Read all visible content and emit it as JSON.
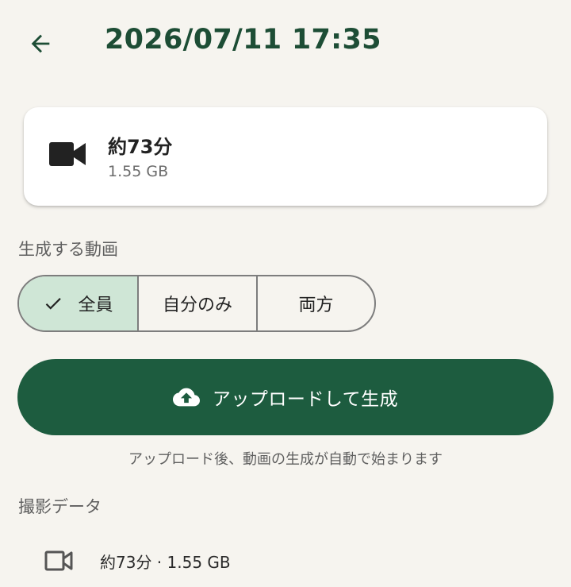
{
  "header": {
    "title": "2026/07/11 17:35",
    "back_icon": "arrow-left-icon"
  },
  "recording": {
    "duration": "約73分",
    "size": "1.55 GB",
    "icon": "videocam-icon"
  },
  "video_section": {
    "label": "生成する動画",
    "options": [
      {
        "label": "全員",
        "selected": true
      },
      {
        "label": "自分のみ",
        "selected": false
      },
      {
        "label": "両方",
        "selected": false
      }
    ]
  },
  "upload": {
    "button_label": "アップロードして生成",
    "hint": "アップロード後、動画の生成が自動で始まります",
    "icon": "cloud-upload-icon"
  },
  "capture_data": {
    "label": "撮影データ",
    "row_text": "約73分 · 1.55 GB",
    "icon": "videocam-outline-icon"
  },
  "colors": {
    "primary": "#1d5c3f",
    "title": "#1d4d35",
    "selected_segment": "#cfe6d6",
    "background": "#f6f4ef"
  }
}
